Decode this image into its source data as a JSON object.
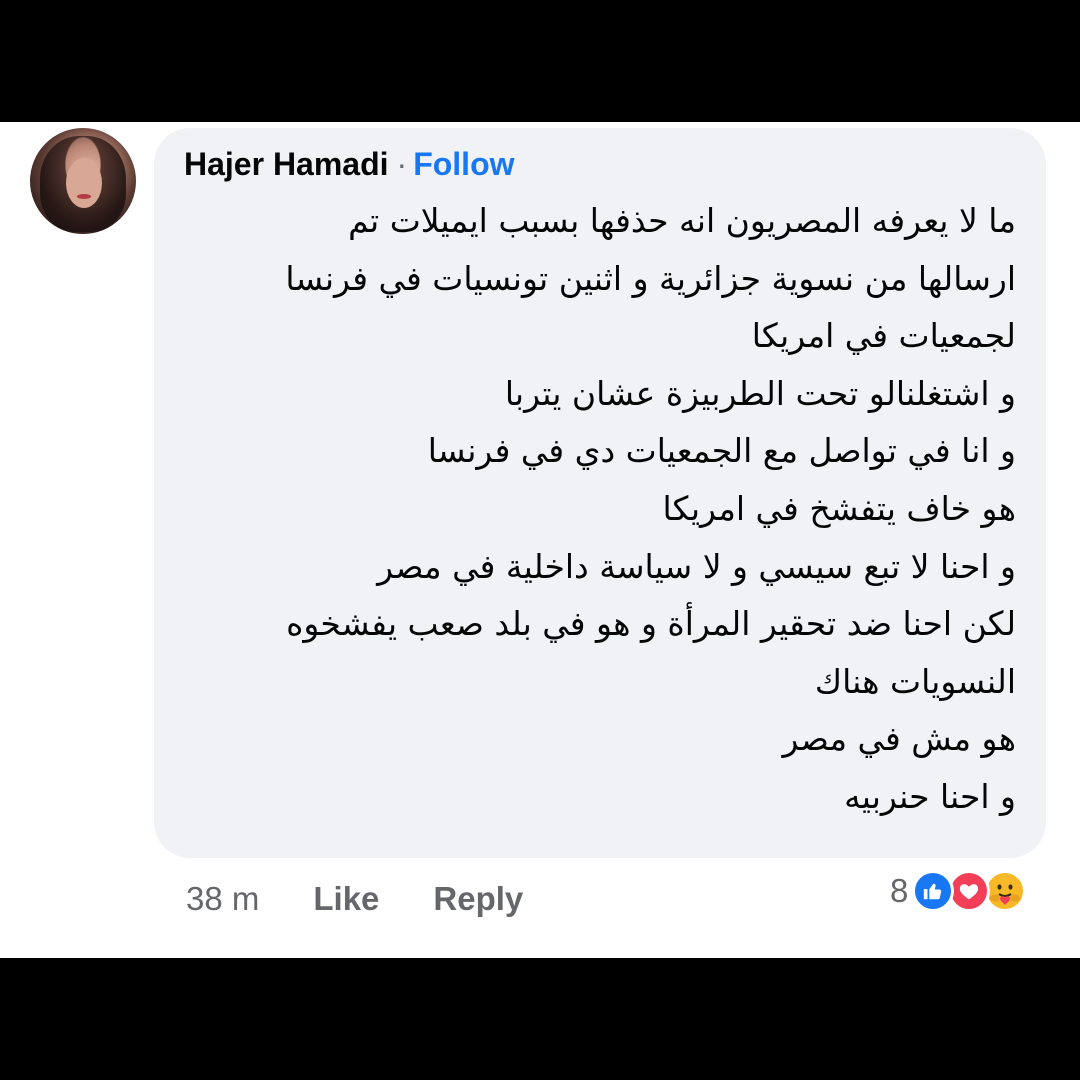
{
  "comment": {
    "author": "Hajer Hamadi",
    "separator": "·",
    "follow_label": "Follow",
    "lines": [
      "ما لا يعرفه المصريون انه حذفها بسبب ايميلات تم",
      "ارسالها من نسوية جزائرية و اثنين تونسيات في فرنسا",
      "لجمعيات في امريكا",
      "و اشتغلنالو تحت الطربيزة عشان يتربا",
      "و انا في تواصل مع الجمعيات دي في فرنسا",
      "هو خاف يتفشخ في امريكا",
      "و احنا لا تبع سيسي و لا سياسة داخلية في مصر",
      "لكن احنا ضد تحقير المرأة و هو في بلد صعب يفشخوه",
      "النسويات هناك",
      "هو مش في مصر",
      "و احنا حنربيه"
    ]
  },
  "actions": {
    "time": "38 m",
    "like_label": "Like",
    "reply_label": "Reply"
  },
  "reactions": {
    "count": "8",
    "types": [
      "like-icon",
      "love-icon",
      "care-icon"
    ]
  },
  "colors": {
    "bubble": "#f0f2f5",
    "follow": "#1877f2",
    "meta": "#65676b",
    "text": "#050505"
  }
}
